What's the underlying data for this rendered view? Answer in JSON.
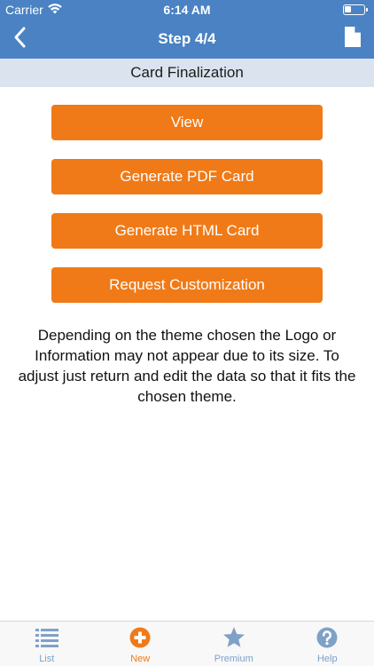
{
  "status_bar": {
    "carrier": "Carrier",
    "time": "6:14 AM"
  },
  "nav": {
    "title": "Step 4/4"
  },
  "section": {
    "title": "Card Finalization"
  },
  "actions": {
    "view": "View",
    "pdf": "Generate PDF Card",
    "html": "Generate HTML Card",
    "customize": "Request Customization"
  },
  "info": {
    "text": "Depending on the theme chosen the Logo or Information may not appear due to its size. To adjust just return and edit the data so that it fits the chosen theme."
  },
  "tabs": [
    {
      "label": "List",
      "icon": "list-icon",
      "active": false
    },
    {
      "label": "New",
      "icon": "plus-circle-icon",
      "active": true
    },
    {
      "label": "Premium",
      "icon": "star-icon",
      "active": false
    },
    {
      "label": "Help",
      "icon": "question-circle-icon",
      "active": false
    }
  ],
  "colors": {
    "nav_blue": "#4a82c3",
    "section_bg": "#dbe3ee",
    "button_orange": "#f07a17",
    "tab_inactive": "#7fa1c8",
    "tab_active": "#f07a17"
  }
}
